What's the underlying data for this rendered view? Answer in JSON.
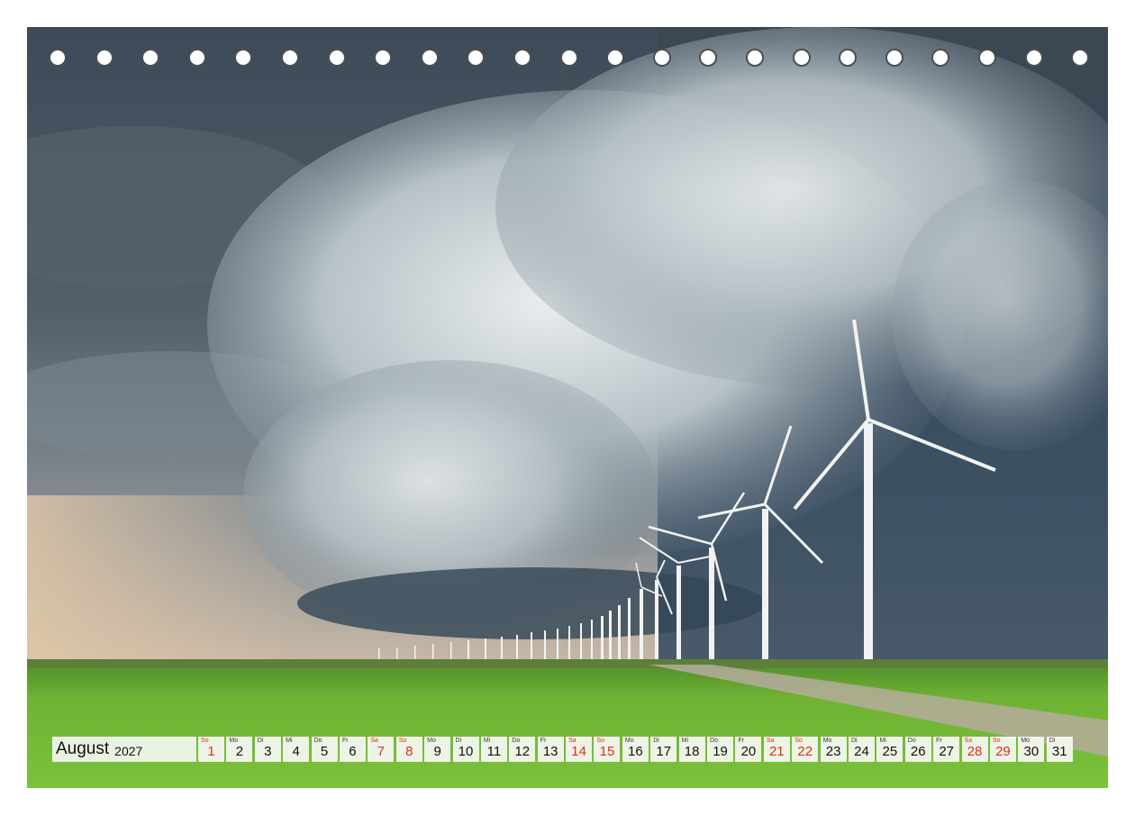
{
  "calendar": {
    "month": "August",
    "year": "2027",
    "days": [
      {
        "wd": "So",
        "d": "1",
        "we": true
      },
      {
        "wd": "Mo",
        "d": "2",
        "we": false
      },
      {
        "wd": "Di",
        "d": "3",
        "we": false
      },
      {
        "wd": "Mi",
        "d": "4",
        "we": false
      },
      {
        "wd": "Do",
        "d": "5",
        "we": false
      },
      {
        "wd": "Fr",
        "d": "6",
        "we": false
      },
      {
        "wd": "Sa",
        "d": "7",
        "we": true
      },
      {
        "wd": "So",
        "d": "8",
        "we": true
      },
      {
        "wd": "Mo",
        "d": "9",
        "we": false
      },
      {
        "wd": "Di",
        "d": "10",
        "we": false
      },
      {
        "wd": "Mi",
        "d": "11",
        "we": false
      },
      {
        "wd": "Do",
        "d": "12",
        "we": false
      },
      {
        "wd": "Fr",
        "d": "13",
        "we": false
      },
      {
        "wd": "Sa",
        "d": "14",
        "we": true
      },
      {
        "wd": "So",
        "d": "15",
        "we": true
      },
      {
        "wd": "Mo",
        "d": "16",
        "we": false
      },
      {
        "wd": "Di",
        "d": "17",
        "we": false
      },
      {
        "wd": "Mi",
        "d": "18",
        "we": false
      },
      {
        "wd": "Do",
        "d": "19",
        "we": false
      },
      {
        "wd": "Fr",
        "d": "20",
        "we": false
      },
      {
        "wd": "Sa",
        "d": "21",
        "we": true
      },
      {
        "wd": "So",
        "d": "22",
        "we": true
      },
      {
        "wd": "Mo",
        "d": "23",
        "we": false
      },
      {
        "wd": "Di",
        "d": "24",
        "we": false
      },
      {
        "wd": "Mi",
        "d": "25",
        "we": false
      },
      {
        "wd": "Do",
        "d": "26",
        "we": false
      },
      {
        "wd": "Fr",
        "d": "27",
        "we": false
      },
      {
        "wd": "Sa",
        "d": "28",
        "we": true
      },
      {
        "wd": "So",
        "d": "29",
        "we": true
      },
      {
        "wd": "Mo",
        "d": "30",
        "we": false
      },
      {
        "wd": "Di",
        "d": "31",
        "we": false
      }
    ]
  },
  "colors": {
    "weekend": "#d8311f",
    "weekday": "#111111"
  }
}
